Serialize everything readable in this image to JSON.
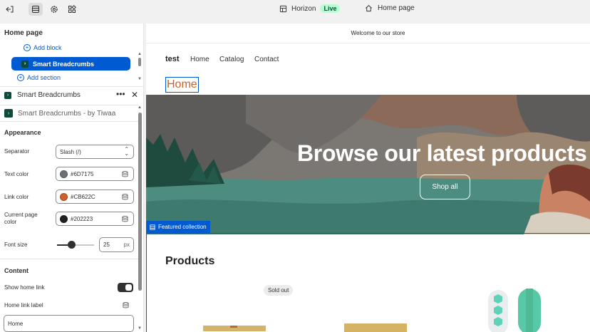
{
  "topbar": {
    "theme_name": "Horizon",
    "live_badge": "Live",
    "page_name": "Home page"
  },
  "sidebar": {
    "section_title": "Home page",
    "add_block": "Add block",
    "selected_block": "Smart Breadcrumbs",
    "add_section": "Add section",
    "block_title": "Smart Breadcrumbs",
    "app_label": "Smart Breadcrumbs - by Tiwaa",
    "appearance_heading": "Appearance",
    "separator_label": "Separator",
    "separator_value": "Slash (/)",
    "text_color_label": "Text color",
    "text_color_value": "#6D7175",
    "link_color_label": "Link color",
    "link_color_value": "#CB622C",
    "current_page_color_label": "Current page color",
    "current_page_color_value": "#202223",
    "font_size_label": "Font size",
    "font_size_value": "25",
    "font_size_unit": "px",
    "content_heading": "Content",
    "show_home_link_label": "Show home link",
    "show_home_link_on": true,
    "home_link_label_label": "Home link label",
    "home_link_label_value": "Home"
  },
  "preview": {
    "announcement": "Welcome to our store",
    "brand": "test",
    "nav": [
      "Home",
      "Catalog",
      "Contact"
    ],
    "breadcrumb": "Home",
    "hero_title": "Browse our latest products",
    "hero_button": "Shop all",
    "featured_tag": "Featured collection",
    "products_title": "Products",
    "sold_out_badge": "Sold out"
  },
  "colors": {
    "accent": "#005bd3",
    "text_color": "#6D7175",
    "link_color": "#CB622C",
    "current_page_color": "#202223",
    "live_badge_bg": "#b4fed2"
  },
  "icons": [
    "exit-icon",
    "sections-icon",
    "settings-icon",
    "apps-icon",
    "theme-icon",
    "home-icon",
    "database-icon"
  ]
}
